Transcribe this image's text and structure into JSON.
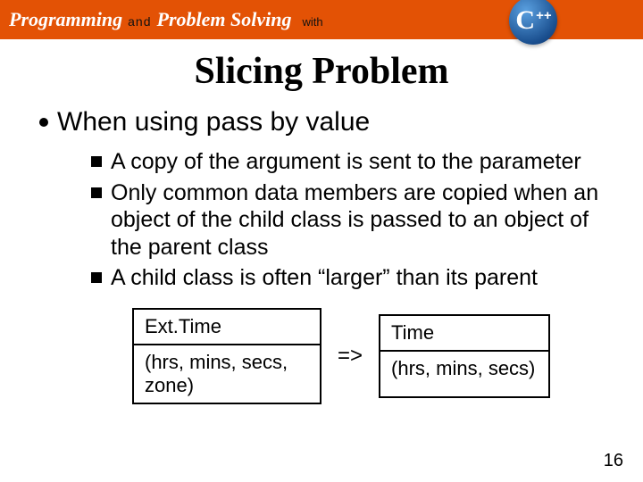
{
  "banner": {
    "word_programming": "Programming",
    "word_and": "and",
    "word_problem_solving": "Problem Solving",
    "word_with": "with",
    "cpp_c": "C",
    "cpp_pp": "++"
  },
  "title": "Slicing Problem",
  "bullet1": "When using pass by value",
  "sub": {
    "a": "A copy of the argument is sent to the parameter",
    "b": "Only common data members are copied when an object of the child class is passed to an object of the parent class",
    "c": "A child class is often “larger” than its parent"
  },
  "table": {
    "left_header": "Ext.Time",
    "left_body": "(hrs, mins, secs, zone)",
    "arrow": "=>",
    "right_header": "Time",
    "right_body": "(hrs, mins, secs)"
  },
  "page_number": "16"
}
